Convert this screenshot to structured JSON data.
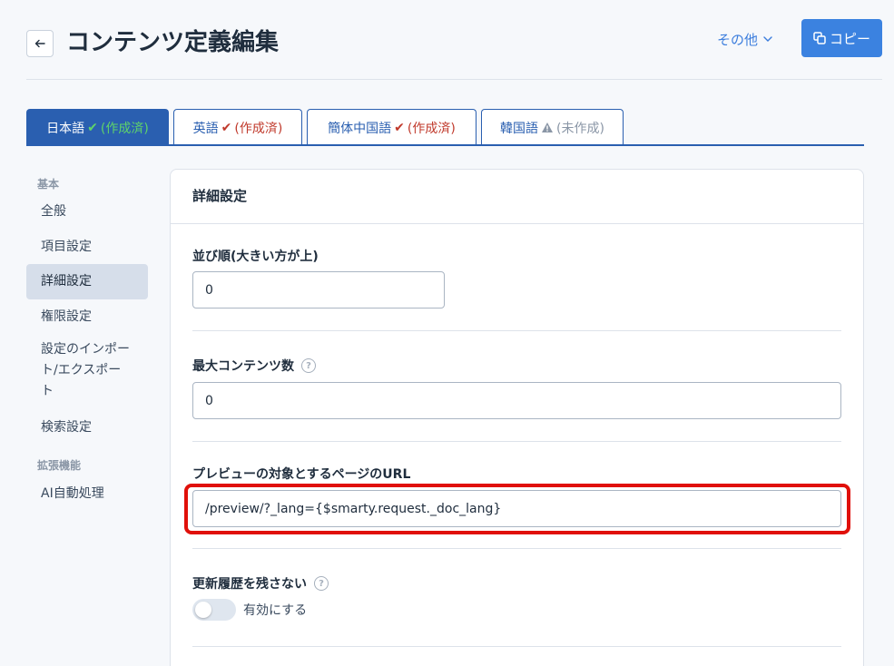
{
  "header": {
    "title": "コンテンツ定義編集",
    "more_label": "その他",
    "copy_label": "コピー"
  },
  "tabs": [
    {
      "lang": "日本語",
      "status": "(作成済)",
      "state": "done",
      "active": true
    },
    {
      "lang": "英語",
      "status": "(作成済)",
      "state": "done",
      "active": false
    },
    {
      "lang": "簡体中国語",
      "status": "(作成済)",
      "state": "done",
      "active": false
    },
    {
      "lang": "韓国語",
      "status": "(未作成)",
      "state": "missing",
      "active": false
    }
  ],
  "sidebar": {
    "section_basic": "基本",
    "items": [
      {
        "label": "全般"
      },
      {
        "label": "項目設定"
      },
      {
        "label": "詳細設定",
        "active": true
      },
      {
        "label": "権限設定"
      },
      {
        "label": "設定のインポート/エクスポート"
      },
      {
        "label": "検索設定"
      }
    ],
    "section_extension": "拡張機能",
    "extension_items": [
      {
        "label": "AI自動処理"
      }
    ]
  },
  "panel": {
    "title": "詳細設定",
    "sort_order": {
      "label": "並び順(大きい方が上)",
      "value": "0"
    },
    "max_contents": {
      "label": "最大コンテンツ数",
      "value": "0"
    },
    "preview_url": {
      "label": "プレビューの対象とするページのURL",
      "value": "/preview/?_lang={$smarty.request._doc_lang}"
    },
    "no_history": {
      "label": "更新履歴を残さない",
      "toggle_label": "有効にする",
      "enabled": false
    }
  },
  "colors": {
    "accent": "#2a5fb0",
    "primary_button": "#3b82e0",
    "highlight_box": "#e0100a",
    "done_check": "#c0392b",
    "done_check_active": "#5fd36a"
  }
}
